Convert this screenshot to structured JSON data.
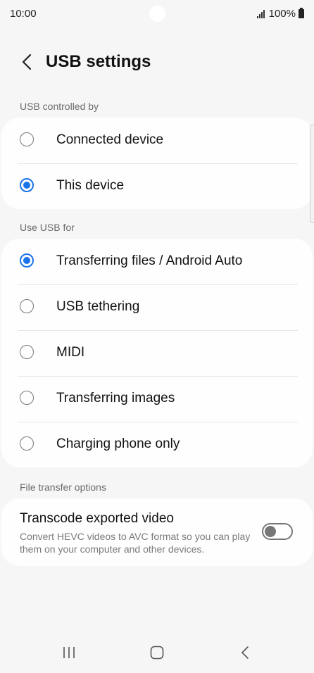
{
  "status_bar": {
    "time": "10:00",
    "battery": "100%"
  },
  "header": {
    "title": "USB settings"
  },
  "sections": {
    "usb_controlled_by": {
      "label": "USB controlled by",
      "options": [
        {
          "label": "Connected device",
          "checked": false
        },
        {
          "label": "This device",
          "checked": true
        }
      ]
    },
    "use_usb_for": {
      "label": "Use USB for",
      "options": [
        {
          "label": "Transferring files / Android Auto",
          "checked": true
        },
        {
          "label": "USB tethering",
          "checked": false
        },
        {
          "label": "MIDI",
          "checked": false
        },
        {
          "label": "Transferring images",
          "checked": false
        },
        {
          "label": "Charging phone only",
          "checked": false
        }
      ]
    },
    "file_transfer_options": {
      "label": "File transfer options",
      "transcode": {
        "title": "Transcode exported video",
        "description": "Convert HEVC videos to AVC format so you can play them on your computer and other devices.",
        "enabled": false
      }
    }
  },
  "colors": {
    "accent": "#1a73e8",
    "background": "#f6f6f6",
    "card": "#fefefe"
  },
  "nav_bar": {
    "icons": [
      "recents-icon",
      "home-icon",
      "back-icon"
    ]
  }
}
